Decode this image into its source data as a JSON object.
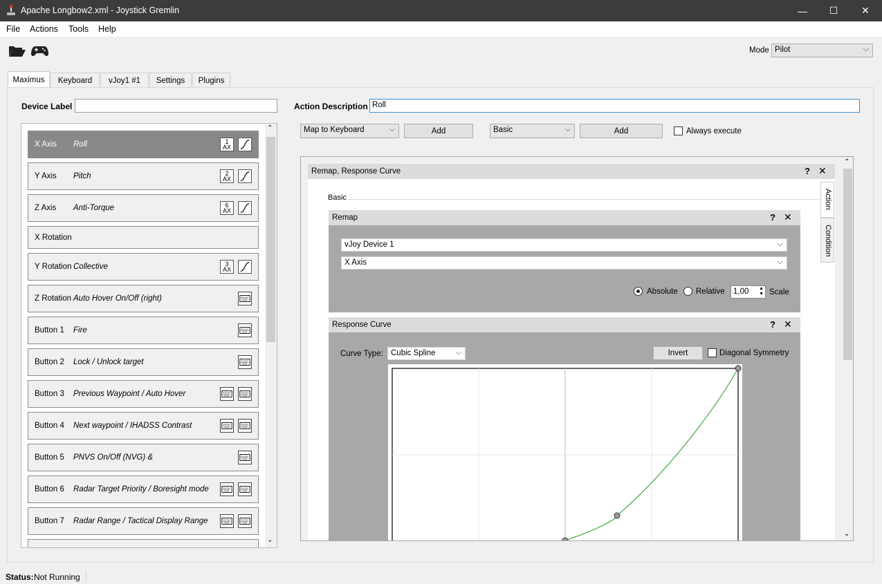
{
  "window": {
    "title": "Apache Longbow2.xml - Joystick Gremlin",
    "controls": [
      "—",
      "☐",
      "✕"
    ]
  },
  "menu": {
    "items": [
      "File",
      "Actions",
      "Tools",
      "Help"
    ]
  },
  "toolbar": {
    "mode_label": "Mode",
    "mode_value": "Pilot",
    "open_icon": "folder-open-icon",
    "device_icon": "gamepad-icon"
  },
  "tabs": [
    "Maximus",
    "Keyboard",
    "vJoy1 #1",
    "Settings",
    "Plugins"
  ],
  "device": {
    "label_text": "Device Label",
    "label_value": ""
  },
  "inputs": [
    {
      "input": "X Axis",
      "desc": "Roll",
      "icons": [
        "axis-1",
        "curve"
      ],
      "ax": "1"
    },
    {
      "input": "Y Axis",
      "desc": "Pitch",
      "icons": [
        "axis-2",
        "curve"
      ],
      "ax": "2"
    },
    {
      "input": "Z Axis",
      "desc": "Anti-Torque",
      "icons": [
        "axis-6",
        "curve"
      ],
      "ax": "6"
    },
    {
      "input": "X Rotation",
      "desc": "",
      "icons": []
    },
    {
      "input": "Y Rotation",
      "desc": "Collective",
      "icons": [
        "axis-3",
        "curve"
      ],
      "ax": "3"
    },
    {
      "input": "Z Rotation",
      "desc": "Auto Hover On/Off (right)",
      "icons": [
        "keyboard"
      ]
    },
    {
      "input": "Button 1",
      "desc": "Fire",
      "icons": [
        "keyboard"
      ]
    },
    {
      "input": "Button 2",
      "desc": "Lock / Unlock target",
      "icons": [
        "keyboard"
      ]
    },
    {
      "input": "Button 3",
      "desc": "Previous Waypoint / Auto Hover",
      "icons": [
        "keyboard",
        "keyboard"
      ]
    },
    {
      "input": "Button 4",
      "desc": "Next waypoint / IHADSS Contrast",
      "icons": [
        "keyboard",
        "keyboard"
      ]
    },
    {
      "input": "Button 5",
      "desc": "PNVS On/Off (NVG) &",
      "icons": [
        "keyboard"
      ]
    },
    {
      "input": "Button 6",
      "desc": "Radar Target Priority / Boresight mode",
      "icons": [
        "keyboard",
        "keyboard"
      ]
    },
    {
      "input": "Button 7",
      "desc": "Radar Range / Tactical Display Range",
      "icons": [
        "keyboard",
        "keyboard"
      ]
    }
  ],
  "action": {
    "description_label": "Action Description",
    "description_value": "Roll",
    "action_select": "Map to Keyboard",
    "add_label": "Add",
    "container_select": "Basic",
    "add2_label": "Add",
    "always_execute": "Always execute"
  },
  "container": {
    "title": "Remap, Response Curve",
    "help": "?",
    "close": "✕",
    "group_label": "Basic",
    "vtabs": [
      "Action",
      "Condition"
    ]
  },
  "remap": {
    "title": "Remap",
    "device": "vJoy Device 1",
    "axis": "X Axis",
    "absolute": "Absolute",
    "relative": "Relative",
    "scale_value": "1,00",
    "scale_label": "Scale"
  },
  "curve": {
    "title": "Response Curve",
    "type_label": "Curve Type:",
    "type_value": "Cubic Spline",
    "invert": "Invert",
    "symmetry": "Diagonal Symmetry"
  },
  "status": {
    "label": "Status:",
    "value": "Not Running"
  }
}
